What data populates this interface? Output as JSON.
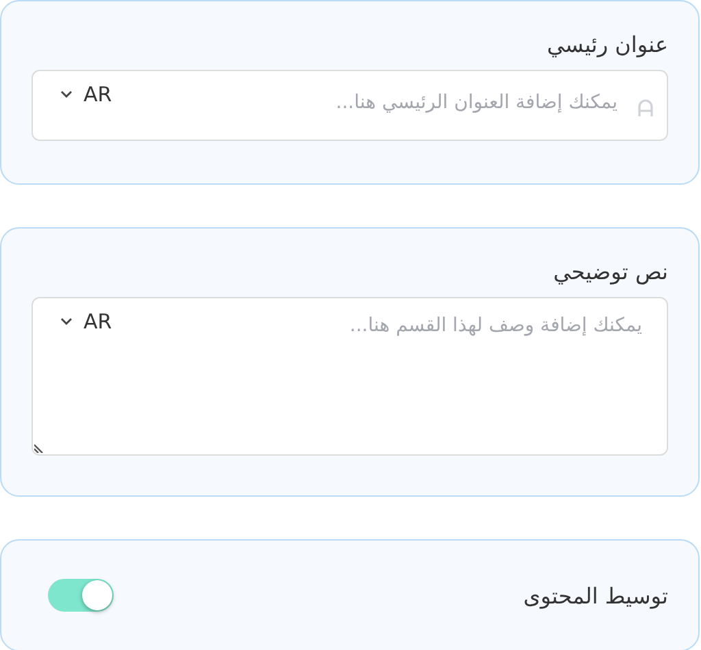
{
  "sections": [
    {
      "kind": "text",
      "label": "عنوان رئيسي",
      "placeholder": "يمكنك إضافة العنوان الرئيسي هنا...",
      "language": "AR"
    },
    {
      "kind": "textarea",
      "label": "نص توضيحي",
      "placeholder": "يمكنك إضافة وصف لهذا القسم هنا...",
      "language": "AR"
    },
    {
      "kind": "toggle",
      "label": "توسيط المحتوى",
      "on": true
    }
  ]
}
